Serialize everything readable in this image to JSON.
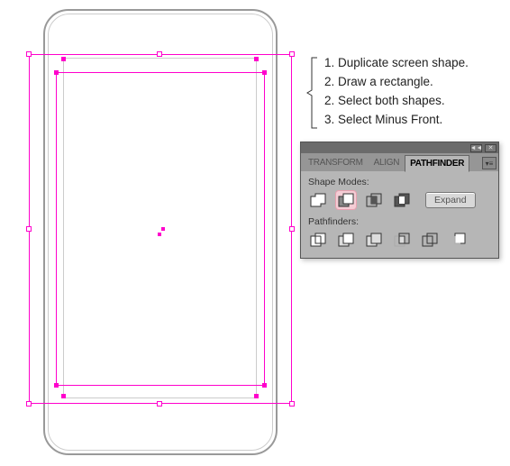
{
  "instructions": {
    "line1": "1. Duplicate screen shape.",
    "line2": "2. Draw a rectangle.",
    "line3": "2. Select both shapes.",
    "line4": "3. Select Minus Front."
  },
  "panel": {
    "tabs": {
      "transform": "TRANSFORM",
      "align": "ALIGN",
      "pathfinder": "PATHFINDER"
    },
    "shape_modes_label": "Shape Modes:",
    "pathfinders_label": "Pathfinders:",
    "expand_label": "Expand",
    "icons": {
      "unite": "unite-icon",
      "minus_front": "minus-front-icon",
      "intersect": "intersect-icon",
      "exclude": "exclude-icon",
      "divide": "divide-icon",
      "trim": "trim-icon",
      "merge": "merge-icon",
      "crop": "crop-icon",
      "outline": "outline-icon",
      "minus_back": "minus-back-icon"
    }
  }
}
